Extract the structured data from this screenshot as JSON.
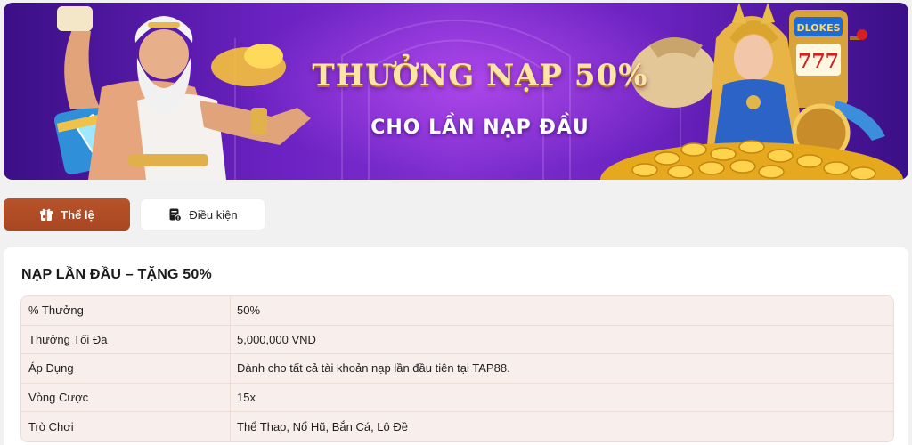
{
  "banner": {
    "title": "THƯỞNG NẠP 50%",
    "subtitle": "CHO LẦN NẠP ĐẦU",
    "slot_sign": "DLOKES",
    "reels": "777"
  },
  "tabs": [
    {
      "label": "Thể lệ",
      "icon": "gift-icon",
      "active": true
    },
    {
      "label": "Điều kiện",
      "icon": "document-icon",
      "active": false
    }
  ],
  "section": {
    "title": "NẠP LẦN ĐẦU – TẶNG 50%",
    "rows": [
      {
        "label": "% Thưởng",
        "value": "50%"
      },
      {
        "label": "Thưởng Tối Đa",
        "value": "5,000,000 VND"
      },
      {
        "label": "Áp Dụng",
        "value": "Dành cho tất cả tài khoản nạp lần đầu tiên tại TAP88."
      },
      {
        "label": "Vòng Cược",
        "value": "15x"
      },
      {
        "label": "Trò Chơi",
        "value": "Thể Thao, Nổ Hũ, Bắn Cá, Lô Đề"
      }
    ]
  },
  "colors": {
    "accent": "#ac4b24",
    "table_bg": "#f8eeec",
    "banner_purple": "#6b22c2",
    "gold": "#f2c14a"
  }
}
